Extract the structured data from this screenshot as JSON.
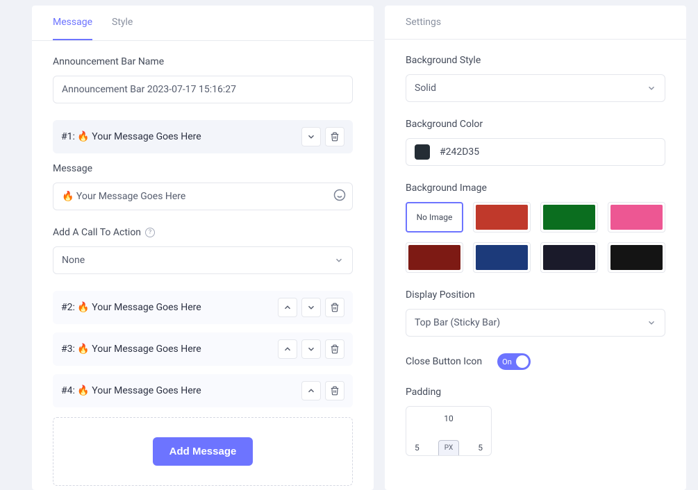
{
  "left": {
    "tabs": {
      "message": "Message",
      "style": "Style"
    },
    "announcement_name_label": "Announcement Bar Name",
    "announcement_name_value": "Announcement Bar 2023-07-17 15:16:27",
    "messages": [
      {
        "title": "#1: 🔥 Your Message Goes Here"
      },
      {
        "title": "#2: 🔥 Your Message Goes Here"
      },
      {
        "title": "#3: 🔥 Your Message Goes Here"
      },
      {
        "title": "#4: 🔥 Your Message Goes Here"
      }
    ],
    "message_label": "Message",
    "message_value": "🔥 Your Message Goes Here",
    "cta_label": "Add A Call To Action",
    "cta_value": "None",
    "add_button": "Add Message"
  },
  "right": {
    "header": "Settings",
    "bg_style_label": "Background Style",
    "bg_style_value": "Solid",
    "bg_color_label": "Background Color",
    "bg_color_value": "#242D35",
    "bg_image_label": "Background Image",
    "bg_no_image": "No Image",
    "bg_tiles": [
      {
        "color": "#ffffff",
        "is_none": true
      },
      {
        "color": "#c0392b"
      },
      {
        "color": "#0b6e1f"
      },
      {
        "color": "#ed5793"
      },
      {
        "color": "#7d1a14"
      },
      {
        "color": "#1c3a7a"
      },
      {
        "color": "#1a1a2a"
      },
      {
        "color": "#141414"
      }
    ],
    "display_pos_label": "Display Position",
    "display_pos_value": "Top Bar (Sticky Bar)",
    "close_btn_label": "Close Button Icon",
    "toggle_label": "On",
    "padding_label": "Padding",
    "padding": {
      "top": "10",
      "left": "5",
      "right": "5",
      "unit": "PX"
    }
  }
}
